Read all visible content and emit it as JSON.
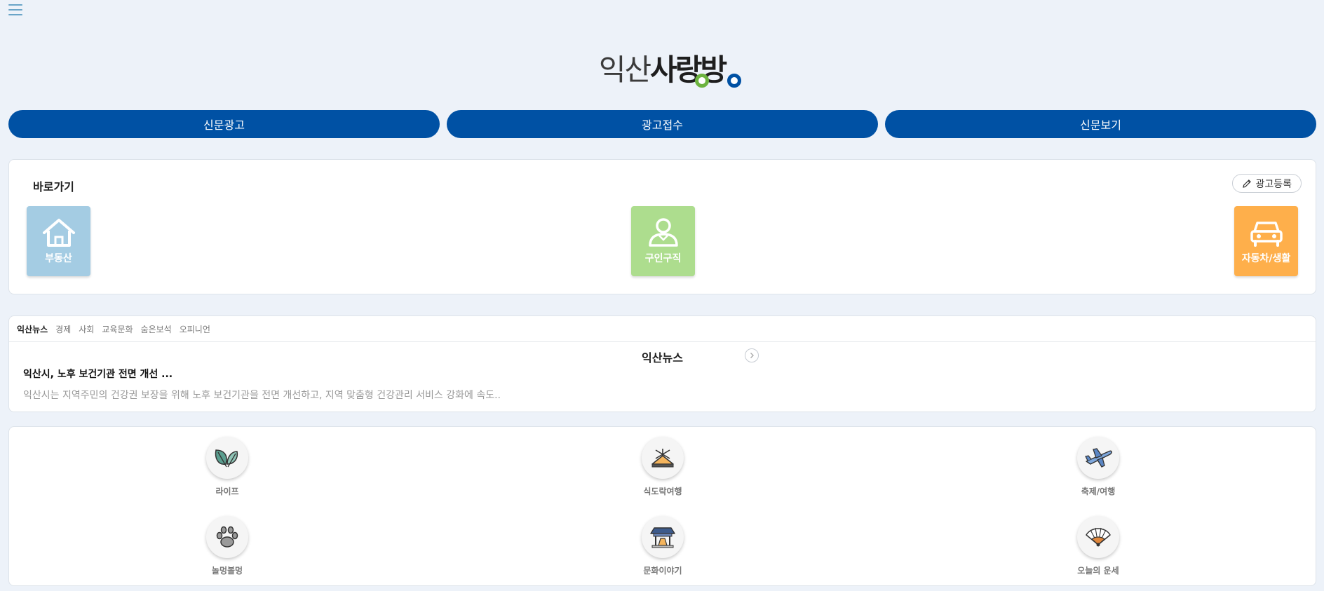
{
  "header": {
    "logo_text_a": "익산",
    "logo_text_b": "사랑방"
  },
  "nav": {
    "buttons": [
      {
        "label": "신문광고"
      },
      {
        "label": "광고접수"
      },
      {
        "label": "신문보기"
      }
    ]
  },
  "shortcut": {
    "title": "바로가기",
    "register_label": "광고등록",
    "tiles": [
      {
        "label": "부동산",
        "icon": "house-icon",
        "color": "#a4cce3"
      },
      {
        "label": "구인구직",
        "icon": "person-icon",
        "color": "#addd8e"
      },
      {
        "label": "자동차/생활",
        "icon": "car-icon",
        "color": "#feaf4b"
      }
    ]
  },
  "news": {
    "tabs": [
      {
        "label": "익산뉴스"
      },
      {
        "label": "경제"
      },
      {
        "label": "사회"
      },
      {
        "label": "교육문화"
      },
      {
        "label": "숨은보석"
      },
      {
        "label": "오피니언"
      }
    ],
    "section_title": "익산뉴스",
    "headline": "익산시, 노후 보건기관 전면 개선 ...",
    "summary": "익산시는 지역주민의 건강권 보장을 위해 노후 보건기관을 전면 개선하고, 지역 맞춤형 건강관리 서비스 강화에 속도.."
  },
  "categories": {
    "items": [
      {
        "label": "라이프",
        "icon": "leaf-icon"
      },
      {
        "label": "식도락여행",
        "icon": "food-dish-icon"
      },
      {
        "label": "축제/여행",
        "icon": "airplane-icon"
      },
      {
        "label": "놀멍볼멍",
        "icon": "paw-icon"
      },
      {
        "label": "문화이야기",
        "icon": "hanok-icon"
      },
      {
        "label": "오늘의 운세",
        "icon": "fan-icon"
      }
    ]
  },
  "colors": {
    "primary": "#0051a4",
    "accent_green": "#6cb33f",
    "background": "#edf2f9"
  }
}
